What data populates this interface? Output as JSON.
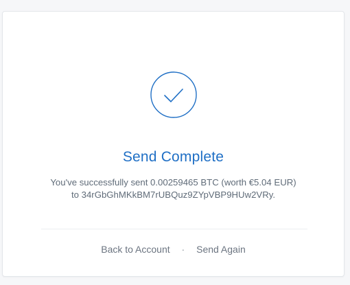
{
  "icons": {
    "success": "checkmark-circle-icon"
  },
  "colors": {
    "accent": "#1f6fc5",
    "text_muted": "#5f6b78",
    "link_muted": "#6b7480"
  },
  "main": {
    "title": "Send Complete",
    "message_line1": "You've successfully sent 0.00259465 BTC (worth €5.04 EUR)",
    "message_line2": "to 34rGbGhMKkBM7rUBQuz9ZYpVBP9HUw2VRy."
  },
  "actions": {
    "back_label": "Back to Account",
    "separator": "·",
    "send_again_label": "Send Again"
  }
}
